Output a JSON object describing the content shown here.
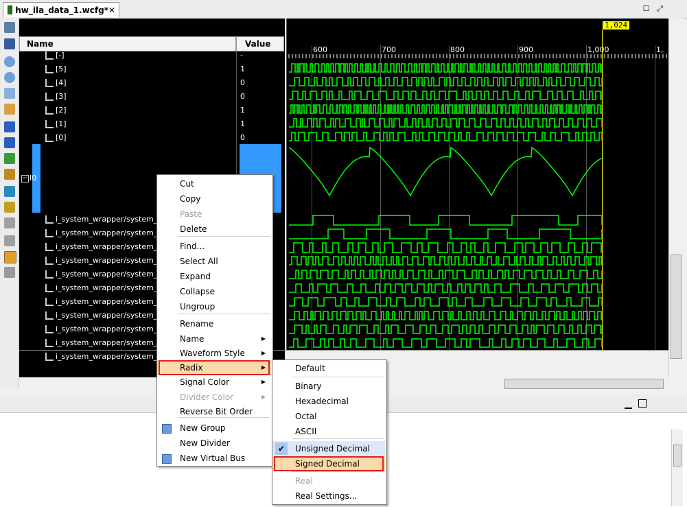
{
  "tab": {
    "title": "hw_ila_data_1.wcfg*",
    "close": "✕"
  },
  "window_controls": {
    "restore": "☐",
    "maximize": "⤢"
  },
  "columns": {
    "name": "Name",
    "value": "Value"
  },
  "bus_rows": [
    {
      "label": "[-]",
      "value": "-"
    },
    {
      "label": "[5]",
      "value": "1"
    },
    {
      "label": "[4]",
      "value": "0"
    },
    {
      "label": "[3]",
      "value": "0"
    },
    {
      "label": "[2]",
      "value": "1"
    },
    {
      "label": "[1]",
      "value": "1"
    },
    {
      "label": "[0]",
      "value": "0"
    }
  ],
  "analog_group": {
    "label": "I0",
    "toggle": "−"
  },
  "probe_rows": [
    "i_system_wrapper/system_i/ila",
    "i_system_wrapper/system_i/ila",
    "i_system_wrapper/system_i/ila",
    "i_system_wrapper/system_i/ila",
    "i_system_wrapper/system_i/ila",
    "i_system_wrapper/system_i/ila",
    "i_system_wrapper/system_i/ila",
    "i_system_wrapper/system_i/ila",
    "i_system_wrapper/system_i/ila",
    "i_system_wrapper/system_i/ila",
    "i_system_wrapper/system_i/ila"
  ],
  "timeline": {
    "ticks": [
      "600",
      "700",
      "800",
      "900",
      "1,000",
      "1,"
    ],
    "cursor": "1,024"
  },
  "context_menu": {
    "items": [
      {
        "label": "Cut",
        "disabled": false
      },
      {
        "label": "Copy",
        "disabled": false
      },
      {
        "label": "Paste",
        "disabled": true
      },
      {
        "label": "Delete",
        "disabled": false
      },
      {
        "label": "Find...",
        "disabled": false
      },
      {
        "label": "Select All",
        "disabled": false
      },
      {
        "label": "Expand",
        "disabled": false
      },
      {
        "label": "Collapse",
        "disabled": false
      },
      {
        "label": "Ungroup",
        "disabled": false
      },
      {
        "label": "Rename",
        "disabled": false
      },
      {
        "label": "Name",
        "disabled": false
      },
      {
        "label": "Waveform Style",
        "disabled": false
      },
      {
        "label": "Radix",
        "disabled": false
      },
      {
        "label": "Signal Color",
        "disabled": false
      },
      {
        "label": "Divider Color",
        "disabled": true
      },
      {
        "label": "Reverse Bit Order",
        "disabled": false
      },
      {
        "label": "New Group",
        "disabled": false
      },
      {
        "label": "New Divider",
        "disabled": false
      },
      {
        "label": "New Virtual Bus",
        "disabled": false
      }
    ]
  },
  "radix_menu": {
    "items": [
      {
        "label": "Default",
        "disabled": false
      },
      {
        "label": "Binary",
        "disabled": false
      },
      {
        "label": "Hexadecimal",
        "disabled": false
      },
      {
        "label": "Octal",
        "disabled": false
      },
      {
        "label": "ASCII",
        "disabled": false
      },
      {
        "label": "Unsigned Decimal",
        "disabled": false,
        "checked": true
      },
      {
        "label": "Signed Decimal",
        "disabled": false
      },
      {
        "label": "Real",
        "disabled": true
      },
      {
        "label": "Real Settings...",
        "disabled": false
      }
    ]
  },
  "colors": {
    "wave": "#00ff00",
    "wave_dark": "#006400",
    "cursor": "#ffff00",
    "highlight": "#e02020",
    "selection": "#3399ff"
  },
  "icons": [
    "import-icon",
    "save-icon",
    "zoom-in-icon",
    "zoom-out-icon",
    "zoom-fit-icon",
    "zoom-cursor-icon",
    "go-first-icon",
    "go-last-icon",
    "prev-transition-icon",
    "next-transition-icon",
    "add-marker-icon",
    "prev-marker-icon",
    "next-marker-icon",
    "swap-cursors-icon",
    "snap-icon",
    "float-ruler-icon"
  ]
}
